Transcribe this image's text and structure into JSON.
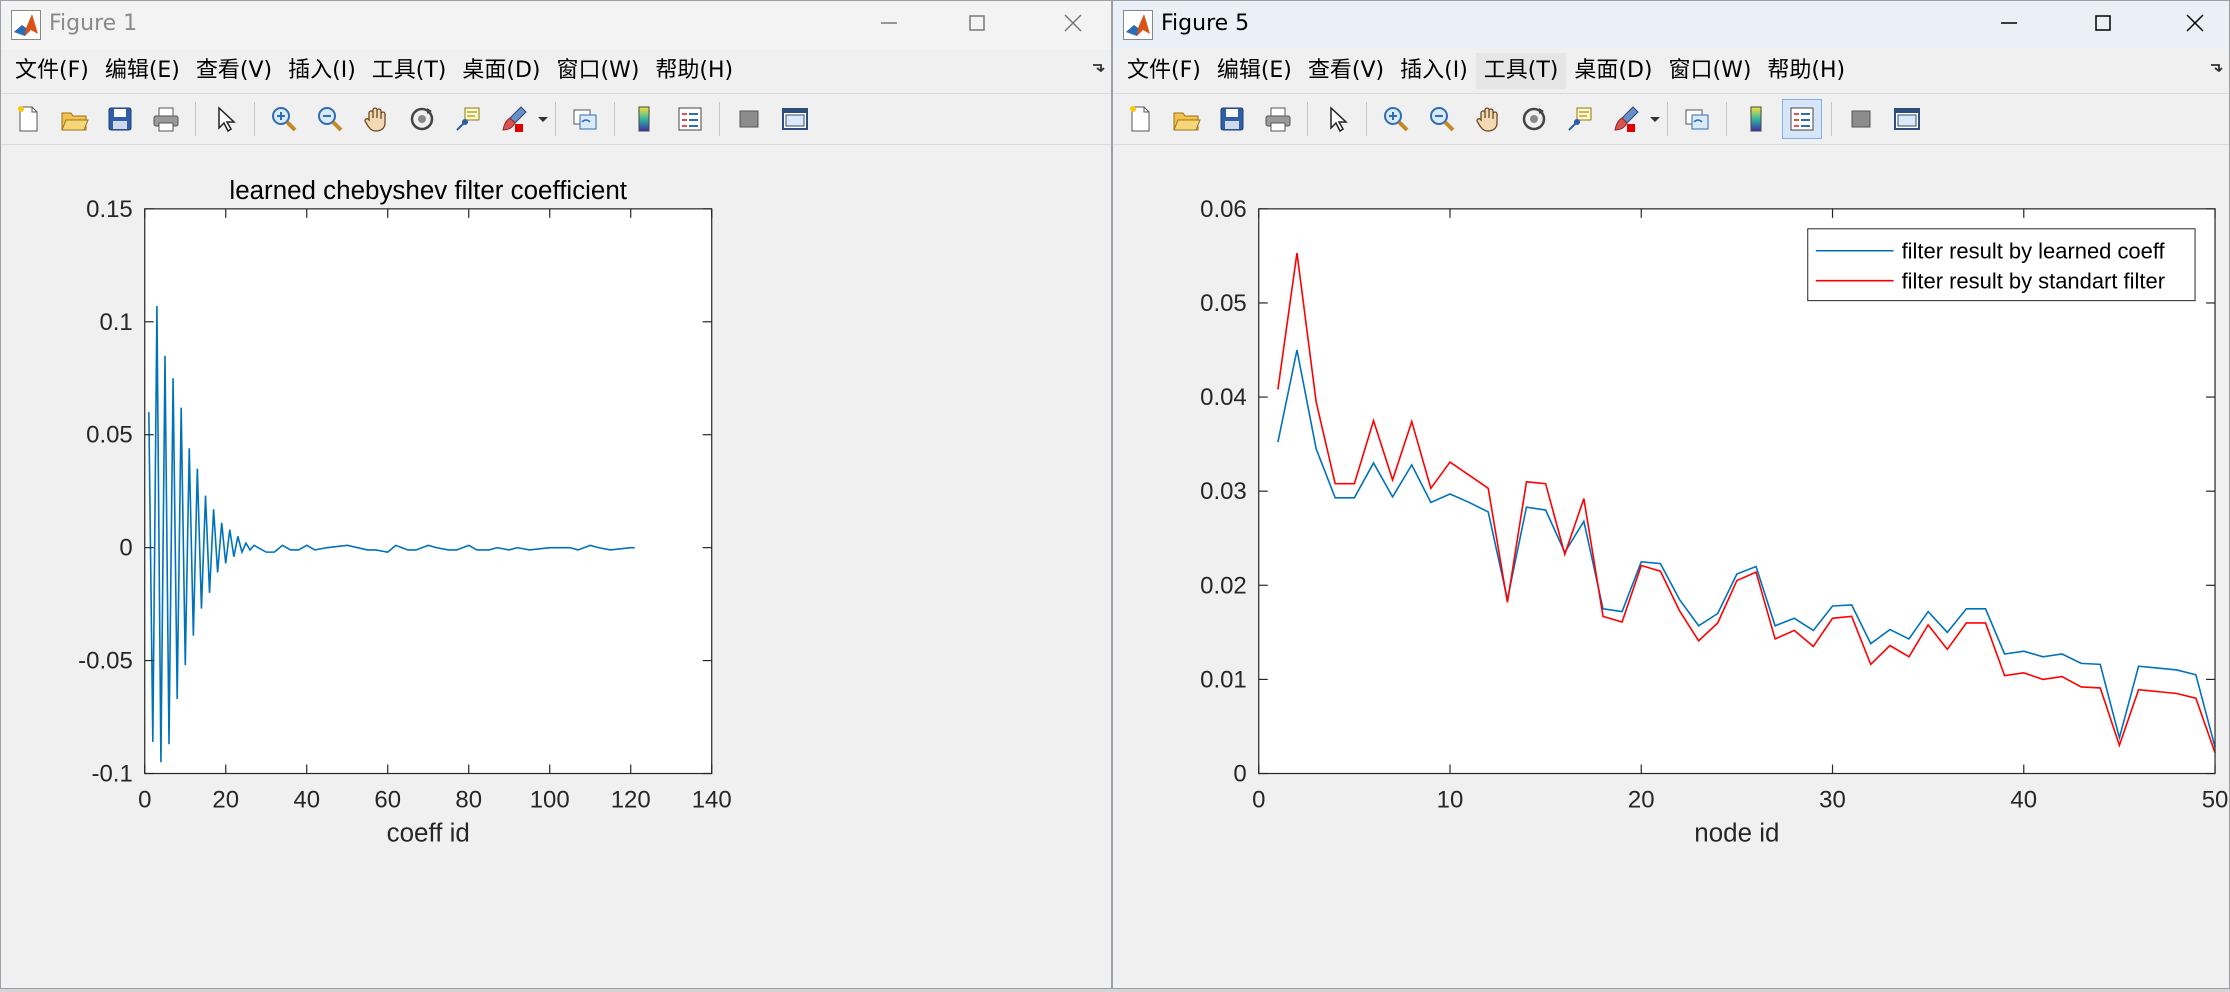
{
  "win1": {
    "title": "Figure 1",
    "menu": [
      "文件(F)",
      "编辑(E)",
      "查看(V)",
      "插入(I)",
      "工具(T)",
      "桌面(D)",
      "窗口(W)",
      "帮助(H)"
    ]
  },
  "win2": {
    "title": "Figure 5",
    "menu": [
      "文件(F)",
      "编辑(E)",
      "查看(V)",
      "插入(I)",
      "工具(T)",
      "桌面(D)",
      "窗口(W)",
      "帮助(H)"
    ]
  },
  "icons": {
    "toolbar": [
      "new-figure-icon",
      "open-file-icon",
      "save-icon",
      "print-icon",
      "edit-plot-arrow-icon",
      "zoom-in-icon",
      "zoom-out-icon",
      "pan-hand-icon",
      "rotate-3d-icon",
      "data-cursor-icon",
      "brush-icon",
      "link-plot-icon",
      "colorbar-icon",
      "legend-icon",
      "hide-plot-tools-icon",
      "show-plot-tools-icon"
    ]
  },
  "colors": {
    "series_blue": "#0072bd",
    "series_red": "#ff0000"
  },
  "chart_data": [
    {
      "type": "line",
      "title": "learned chebyshev filter coefficient",
      "xlabel": "coeff id",
      "ylabel": "",
      "xlim": [
        0,
        140
      ],
      "ylim": [
        -0.1,
        0.15
      ],
      "xticks": [
        0,
        20,
        40,
        60,
        80,
        100,
        120,
        140
      ],
      "yticks": [
        -0.1,
        -0.05,
        0,
        0.05,
        0.1,
        0.15
      ],
      "xtick_labels": [
        "0",
        "20",
        "40",
        "60",
        "80",
        "100",
        "120",
        "140"
      ],
      "ytick_labels": [
        "-0.1",
        "-0.05",
        "0",
        "0.05",
        "0.1",
        "0.15"
      ],
      "grid": false,
      "series": [
        {
          "color": "#0072bd",
          "x": [
            1,
            2,
            3,
            4,
            5,
            6,
            7,
            8,
            9,
            10,
            11,
            12,
            13,
            14,
            15,
            16,
            17,
            18,
            19,
            20,
            21,
            22,
            23,
            24,
            25,
            26,
            27,
            28,
            30,
            32,
            34,
            36,
            38,
            40,
            42,
            45,
            50,
            55,
            57,
            60,
            62,
            65,
            67,
            70,
            72,
            75,
            77,
            80,
            82,
            85,
            87,
            90,
            92,
            95,
            100,
            105,
            107,
            110,
            112,
            115,
            120,
            121
          ],
          "y": [
            0.06,
            -0.086,
            0.107,
            -0.095,
            0.085,
            -0.087,
            0.075,
            -0.067,
            0.062,
            -0.052,
            0.044,
            -0.039,
            0.035,
            -0.027,
            0.023,
            -0.02,
            0.017,
            -0.011,
            0.011,
            -0.007,
            0.008,
            -0.004,
            0.005,
            -0.002,
            0.002,
            -0.001,
            0.001,
            0,
            -0.002,
            -0.002,
            0.001,
            -0.001,
            -0.001,
            0.001,
            -0.001,
            0,
            0.001,
            -0.001,
            -0.001,
            -0.002,
            0.001,
            -0.001,
            -0.001,
            0.001,
            0,
            -0.001,
            -0.001,
            0.001,
            -0.001,
            -0.001,
            0,
            -0.001,
            0,
            -0.001,
            0,
            0,
            -0.001,
            0.001,
            0,
            -0.001,
            0,
            0
          ]
        }
      ]
    },
    {
      "type": "line",
      "title": "",
      "xlabel": "node id",
      "ylabel": "",
      "xlim": [
        0,
        50
      ],
      "ylim": [
        0,
        0.06
      ],
      "xticks": [
        0,
        10,
        20,
        30,
        40,
        50
      ],
      "yticks": [
        0,
        0.01,
        0.02,
        0.03,
        0.04,
        0.05,
        0.06
      ],
      "xtick_labels": [
        "0",
        "10",
        "20",
        "30",
        "40",
        "50"
      ],
      "ytick_labels": [
        "0",
        "0.01",
        "0.02",
        "0.03",
        "0.04",
        "0.05",
        "0.06"
      ],
      "grid": false,
      "legend_position": "top-right",
      "series": [
        {
          "name": "filter result by learned coeff",
          "color": "#0072bd",
          "x": [
            1,
            2,
            3,
            4,
            5,
            6,
            7,
            8,
            9,
            10,
            11,
            12,
            13,
            14,
            15,
            16,
            17,
            18,
            19,
            20,
            21,
            22,
            23,
            24,
            25,
            26,
            27,
            28,
            29,
            30,
            31,
            32,
            33,
            34,
            35,
            36,
            37,
            38,
            39,
            40,
            41,
            42,
            43,
            44,
            45,
            46,
            47,
            48,
            49,
            50
          ],
          "y": [
            0.0352,
            0.045,
            0.0345,
            0.0293,
            0.0293,
            0.033,
            0.0294,
            0.0328,
            0.0288,
            0.0297,
            0.0288,
            0.0278,
            0.0185,
            0.0283,
            0.028,
            0.0235,
            0.0268,
            0.0175,
            0.0172,
            0.0225,
            0.0223,
            0.0185,
            0.0157,
            0.017,
            0.0212,
            0.022,
            0.0157,
            0.0165,
            0.0152,
            0.0178,
            0.0179,
            0.0138,
            0.0153,
            0.0143,
            0.0172,
            0.015,
            0.0175,
            0.0175,
            0.0127,
            0.013,
            0.0124,
            0.0127,
            0.0117,
            0.0116,
            0.0038,
            0.0114,
            0.0112,
            0.011,
            0.0105,
            0.0028
          ]
        },
        {
          "name": "filter result by standart filter",
          "color": "#ff0000",
          "x": [
            1,
            2,
            3,
            4,
            5,
            6,
            7,
            8,
            9,
            10,
            11,
            12,
            13,
            14,
            15,
            16,
            17,
            18,
            19,
            20,
            21,
            22,
            23,
            24,
            25,
            26,
            27,
            28,
            29,
            30,
            31,
            32,
            33,
            34,
            35,
            36,
            37,
            38,
            39,
            40,
            41,
            42,
            43,
            44,
            45,
            46,
            47,
            48,
            49,
            50
          ],
          "y": [
            0.0408,
            0.0553,
            0.0395,
            0.0308,
            0.0308,
            0.0375,
            0.0312,
            0.0374,
            0.0303,
            0.0331,
            0.0317,
            0.0303,
            0.0182,
            0.031,
            0.0308,
            0.0233,
            0.0292,
            0.0167,
            0.0161,
            0.0221,
            0.0215,
            0.0173,
            0.0141,
            0.016,
            0.0205,
            0.0214,
            0.0143,
            0.0152,
            0.0135,
            0.0165,
            0.0167,
            0.0116,
            0.0136,
            0.0124,
            0.0158,
            0.0132,
            0.016,
            0.016,
            0.0104,
            0.0107,
            0.01,
            0.0103,
            0.0092,
            0.0091,
            0.003,
            0.0089,
            0.0087,
            0.0085,
            0.008,
            0.0022
          ]
        }
      ]
    }
  ]
}
